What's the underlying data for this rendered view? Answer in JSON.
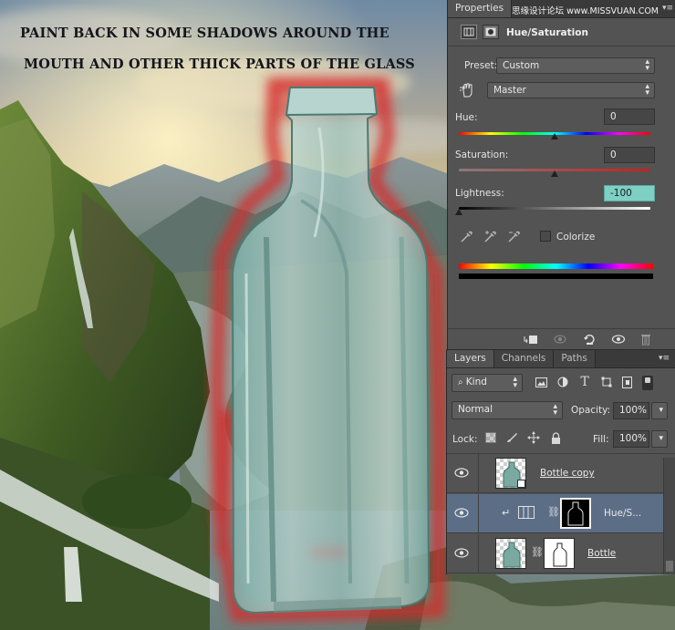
{
  "caption": {
    "line1": "PAINT BACK IN SOME SHADOWS AROUND THE",
    "line2": "MOUTH AND OTHER THICK PARTS OF THE GLASS"
  },
  "watermark": "思缘设计论坛 www.MISSVUAN.COM",
  "properties": {
    "tab_label": "Properties",
    "adjustment_title": "Hue/Saturation",
    "preset_label": "Preset:",
    "preset_value": "Custom",
    "channel_value": "Master",
    "hue_label": "Hue:",
    "hue_value": "0",
    "saturation_label": "Saturation:",
    "saturation_value": "0",
    "lightness_label": "Lightness:",
    "lightness_value": "-100",
    "colorize_label": "Colorize"
  },
  "layers": {
    "tabs": [
      "Layers",
      "Channels",
      "Paths"
    ],
    "kind_label": "Kind",
    "blend_mode": "Normal",
    "opacity_label": "Opacity:",
    "opacity_value": "100%",
    "lock_label": "Lock:",
    "fill_label": "Fill:",
    "fill_value": "100%",
    "rows": [
      {
        "name": "Bottle copy"
      },
      {
        "name": "Hue/S..."
      },
      {
        "name": "Bottle"
      }
    ]
  }
}
